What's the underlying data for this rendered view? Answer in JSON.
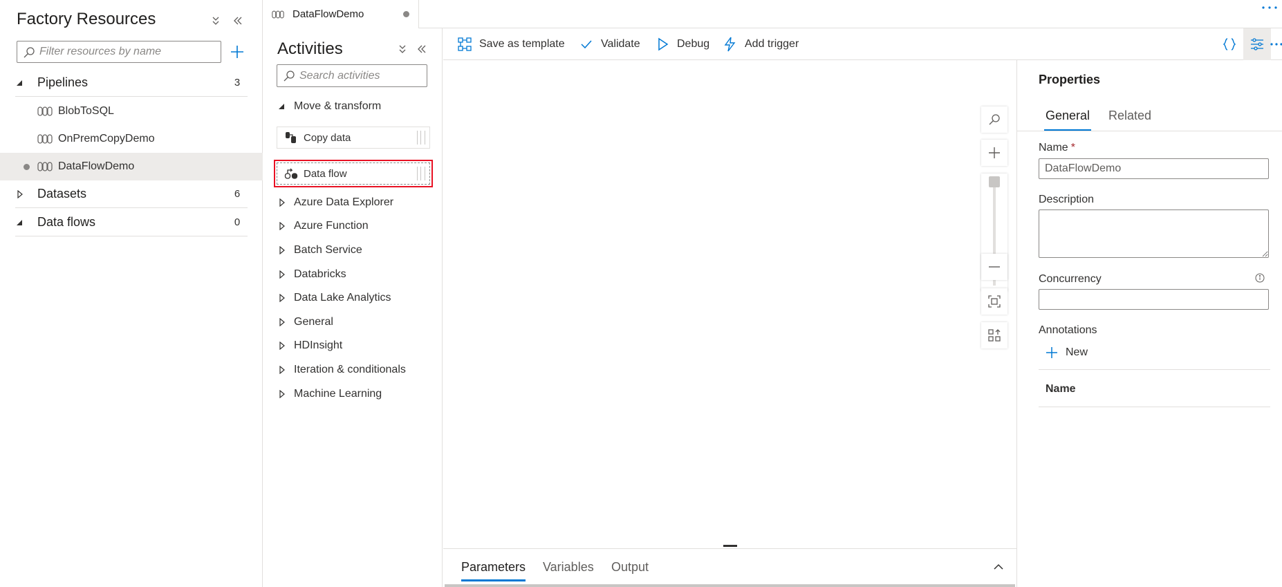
{
  "factory": {
    "title": "Factory Resources",
    "search_placeholder": "Filter resources by name",
    "sections": [
      {
        "label": "Pipelines",
        "count": "3"
      },
      {
        "label": "Datasets",
        "count": "6"
      },
      {
        "label": "Data flows",
        "count": "0"
      }
    ],
    "pipelines": [
      "BlobToSQL",
      "OnPremCopyDemo",
      "DataFlowDemo"
    ]
  },
  "tab": {
    "label": "DataFlowDemo"
  },
  "activities": {
    "title": "Activities",
    "search_placeholder": "Search activities",
    "expanded_group": "Move & transform",
    "items": [
      "Copy data",
      "Data flow"
    ],
    "groups": [
      "Azure Data Explorer",
      "Azure Function",
      "Batch Service",
      "Databricks",
      "Data Lake Analytics",
      "General",
      "HDInsight",
      "Iteration & conditionals",
      "Machine Learning"
    ]
  },
  "toolbar": {
    "save_template": "Save as template",
    "validate": "Validate",
    "debug": "Debug",
    "add_trigger": "Add trigger"
  },
  "bottom_tabs": [
    "Parameters",
    "Variables",
    "Output"
  ],
  "properties": {
    "title": "Properties",
    "tabs": [
      "General",
      "Related"
    ],
    "name_label": "Name",
    "name_required": "*",
    "name_value": "DataFlowDemo",
    "description_label": "Description",
    "concurrency_label": "Concurrency",
    "annotations_label": "Annotations",
    "new_label": "New",
    "annotations_column": "Name"
  },
  "colors": {
    "accent": "#0078d4",
    "highlight": "#e81123"
  }
}
